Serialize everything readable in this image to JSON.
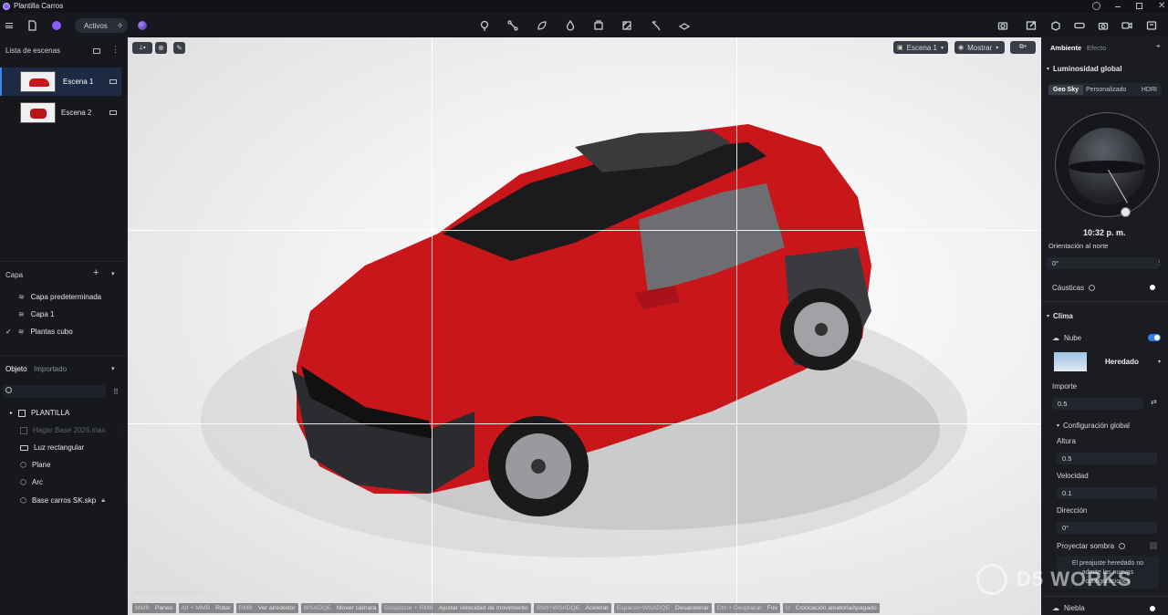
{
  "app": {
    "title": "Plantilla Carros"
  },
  "toolbar": {
    "activos_label": "Activos"
  },
  "left": {
    "scene_list_title": "Lista de escenas",
    "scenes": [
      {
        "label": "Escena 1"
      },
      {
        "label": "Escena 2"
      }
    ],
    "layer_title": "Capa",
    "layers": [
      {
        "label": "Capa predeterminada"
      },
      {
        "label": "Capa 1"
      },
      {
        "label": "Plantas cubo"
      }
    ],
    "object_tab": "Objeto",
    "imported_tab": "Importado",
    "tree": [
      {
        "label": "PLANTILLA"
      },
      {
        "label": "Hagar Base 2026.max"
      },
      {
        "label": "Luz rectangular"
      },
      {
        "label": "Plane"
      },
      {
        "label": "Arc"
      },
      {
        "label": "Base carros SK.skp"
      }
    ]
  },
  "viewport": {
    "scene_select": "Escena 1",
    "show_label": "Mostrar",
    "speed_text": "Velocidad de Movimiento: 1",
    "hints": [
      {
        "k": "MMB",
        "v": "Paneo"
      },
      {
        "k": "Alt + MMB",
        "v": "Rotar"
      },
      {
        "k": "RMB",
        "v": "Ver alrededor"
      },
      {
        "k": "WSADQE",
        "v": "Mover cámara"
      },
      {
        "k": "Desplazar + RMB",
        "v": "Ajustar velocidad de movimiento"
      },
      {
        "k": "Shift+WSADQE",
        "v": "Acelerar"
      },
      {
        "k": "Espacio+WSADQE",
        "v": "Desacelerar"
      },
      {
        "k": "Ctrl + Desplazar",
        "v": "Fov"
      },
      {
        "k": "U",
        "v": "Colocación aleatoriaApagado"
      }
    ]
  },
  "right": {
    "tab_ambient": "Ambiente",
    "tab_effect": "Efecto",
    "global_light_title": "Luminosidad global",
    "sky_tabs": [
      "Geo Sky",
      "Personalizado",
      "HDRI"
    ],
    "time": "10:32 p. m.",
    "north_label": "Orientación al norte",
    "north_value": "0°",
    "caustics_label": "Cáusticas",
    "climate_title": "Clima",
    "cloud_label": "Nube",
    "cloud_preset": "Heredado",
    "amount_label": "Importe",
    "amount_value": "0.5",
    "global_config_title": "Configuración global",
    "height_label": "Altura",
    "height_value": "0.5",
    "speed_label": "Velocidad",
    "speed_value": "0.1",
    "direction_label": "Dirección",
    "direction_value": "0°",
    "shadow_label": "Proyectar sombra",
    "note": "El preajuste heredado no admite las nuevas configuraciones",
    "fog_label": "Niebla"
  },
  "watermark": "D5 WORKS",
  "colors": {
    "accent": "#2f80ed",
    "car_red": "#c8161a",
    "selected_row": "#1c2a44"
  }
}
